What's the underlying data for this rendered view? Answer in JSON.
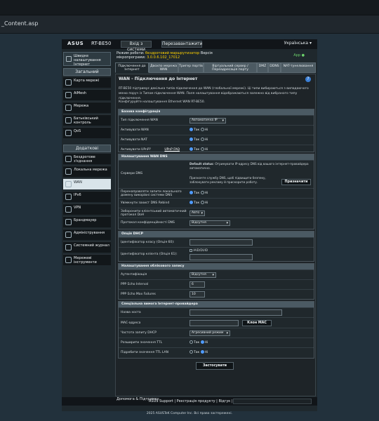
{
  "browser": {
    "url_fragment": "_Content.asp"
  },
  "header": {
    "logo": "ASUS",
    "model": "RT-BE50",
    "login_label": "Вхід з системи",
    "reboot_label": "Перезавантажити",
    "language": "Українська"
  },
  "sidebar": {
    "qis_label": "Швидке налаштування Інтернет",
    "group_general": "Загальний",
    "group_advanced": "Додаткові налаштування",
    "general_items": [
      "Карта мережі",
      "AiMesh",
      "Мережа",
      "Батьківський контроль",
      "QoS"
    ],
    "advanced_items": [
      "Бездротове з'єднання",
      "Локальна мережа",
      "WAN",
      "IPv6",
      "VPN",
      "Брандмауер",
      "Адміністрування",
      "Системний журнал",
      "Мережеві інструменти"
    ]
  },
  "info": {
    "mode_label": "Режим роботи:",
    "mode_value": "бездротовий маршрутизатор",
    "version_label": "Версія",
    "firmware_label": "мікропрограми:",
    "firmware_value": "3.0.0.6.102_17012",
    "app_label": "App"
  },
  "tabs": [
    "Підключення до Інтернет",
    "Двохпо мережа WAN",
    "Тригер портів",
    "Віртуальний сервер / Переадресація порту",
    "DMZ",
    "DDNS",
    "NAT-тунелювання"
  ],
  "panel": {
    "title": "WAN - Підключення до Інтернет",
    "desc": "RT-BE50 підтримує декілька типів підключення до WAN (глобальної мережі). Ці типи вибираються з випадаючого меню поруч із Типом підключення WAN. Поля налаштування відображаються залежно від вибраного типу підключення.",
    "note": "Конфігуруйте налаштування Ethernet WAN RT-BE50."
  },
  "basic": {
    "header": "Базова конфігурація",
    "rows": [
      {
        "label": "Тип підключення WAN",
        "kind": "select",
        "value": "Автоматична IP"
      },
      {
        "label": "Активувати WAN",
        "kind": "radio",
        "yes": "Так",
        "no": "Ні"
      },
      {
        "label": "Активувати NAT",
        "kind": "radio",
        "yes": "Так",
        "no": "Ні"
      },
      {
        "label": "Активувати UPnP?",
        "kind": "radio",
        "link": "UPnP FAQ",
        "yes": "Так",
        "no": "Ні"
      }
    ]
  },
  "dns": {
    "header": "Налаштування WAN DNS",
    "server_label": "Сервери DNS",
    "default_status_label": "Default status",
    "default_status_text": ": Отримувати IP-адресу DNS від вашого інтернет-провайдера автоматично.",
    "note": "Призначте службу DNS, щоб підвищити безпеку, заблокувати рекламу й прискорити роботу.",
    "assign_button": "Призначити",
    "rows": [
      {
        "label": "Перенаправляти запити локального домену викорівні системи DNS",
        "kind": "radio",
        "yes": "Так",
        "no": "Ні"
      },
      {
        "label": "Увімкнути захист DNS Rebind",
        "kind": "radio",
        "yes": "Так",
        "no": "Ні"
      },
      {
        "label": "Заборонити клієнтський автоматичний протокол DoH",
        "kind": "select",
        "value": "Авто"
      },
      {
        "label": "Протокол конфіденційності DNS",
        "kind": "select",
        "value": "Відсутня"
      }
    ]
  },
  "dhcp": {
    "header": "Опція DHCP",
    "class_label": "Ідентифікатор класу (Опція 60):",
    "client_label": "Ідентифікатор клієнта (Опція 61):",
    "iaid_label": "IAID/DUID"
  },
  "account": {
    "header": "Налаштування облікового запису",
    "auth_label": "Аутентифікація",
    "auth_value": "Відсутня",
    "echo_interval_label": "PPP Echo Interval",
    "echo_interval_value": "6",
    "echo_failures_label": "PPP Echo Max Failures",
    "echo_failures_value": "10"
  },
  "isp": {
    "header": "Спеціальна вимога Інтернет-провайдера",
    "hostname_label": "Назва хоста",
    "mac_label": "MAC-адреса",
    "clone_button": "Клон MAC",
    "dhcp_freq_label": "Частота запиту DHCP",
    "dhcp_freq_value": "Агресивний режим",
    "ttl_label": "Розширити значення TTL",
    "ttl_lan_label": "Підробити значення TTL LAN",
    "yes": "Так",
    "no": "Ні"
  },
  "apply_label": "Застосувати",
  "footer": {
    "help_label": "Допомога & Підтримку",
    "links": "ASUS Support | Реєстрація продукту | Відгук | FAQ",
    "copyright": "2025 ASUSTeK Computer Inc. Всі права застережені."
  }
}
